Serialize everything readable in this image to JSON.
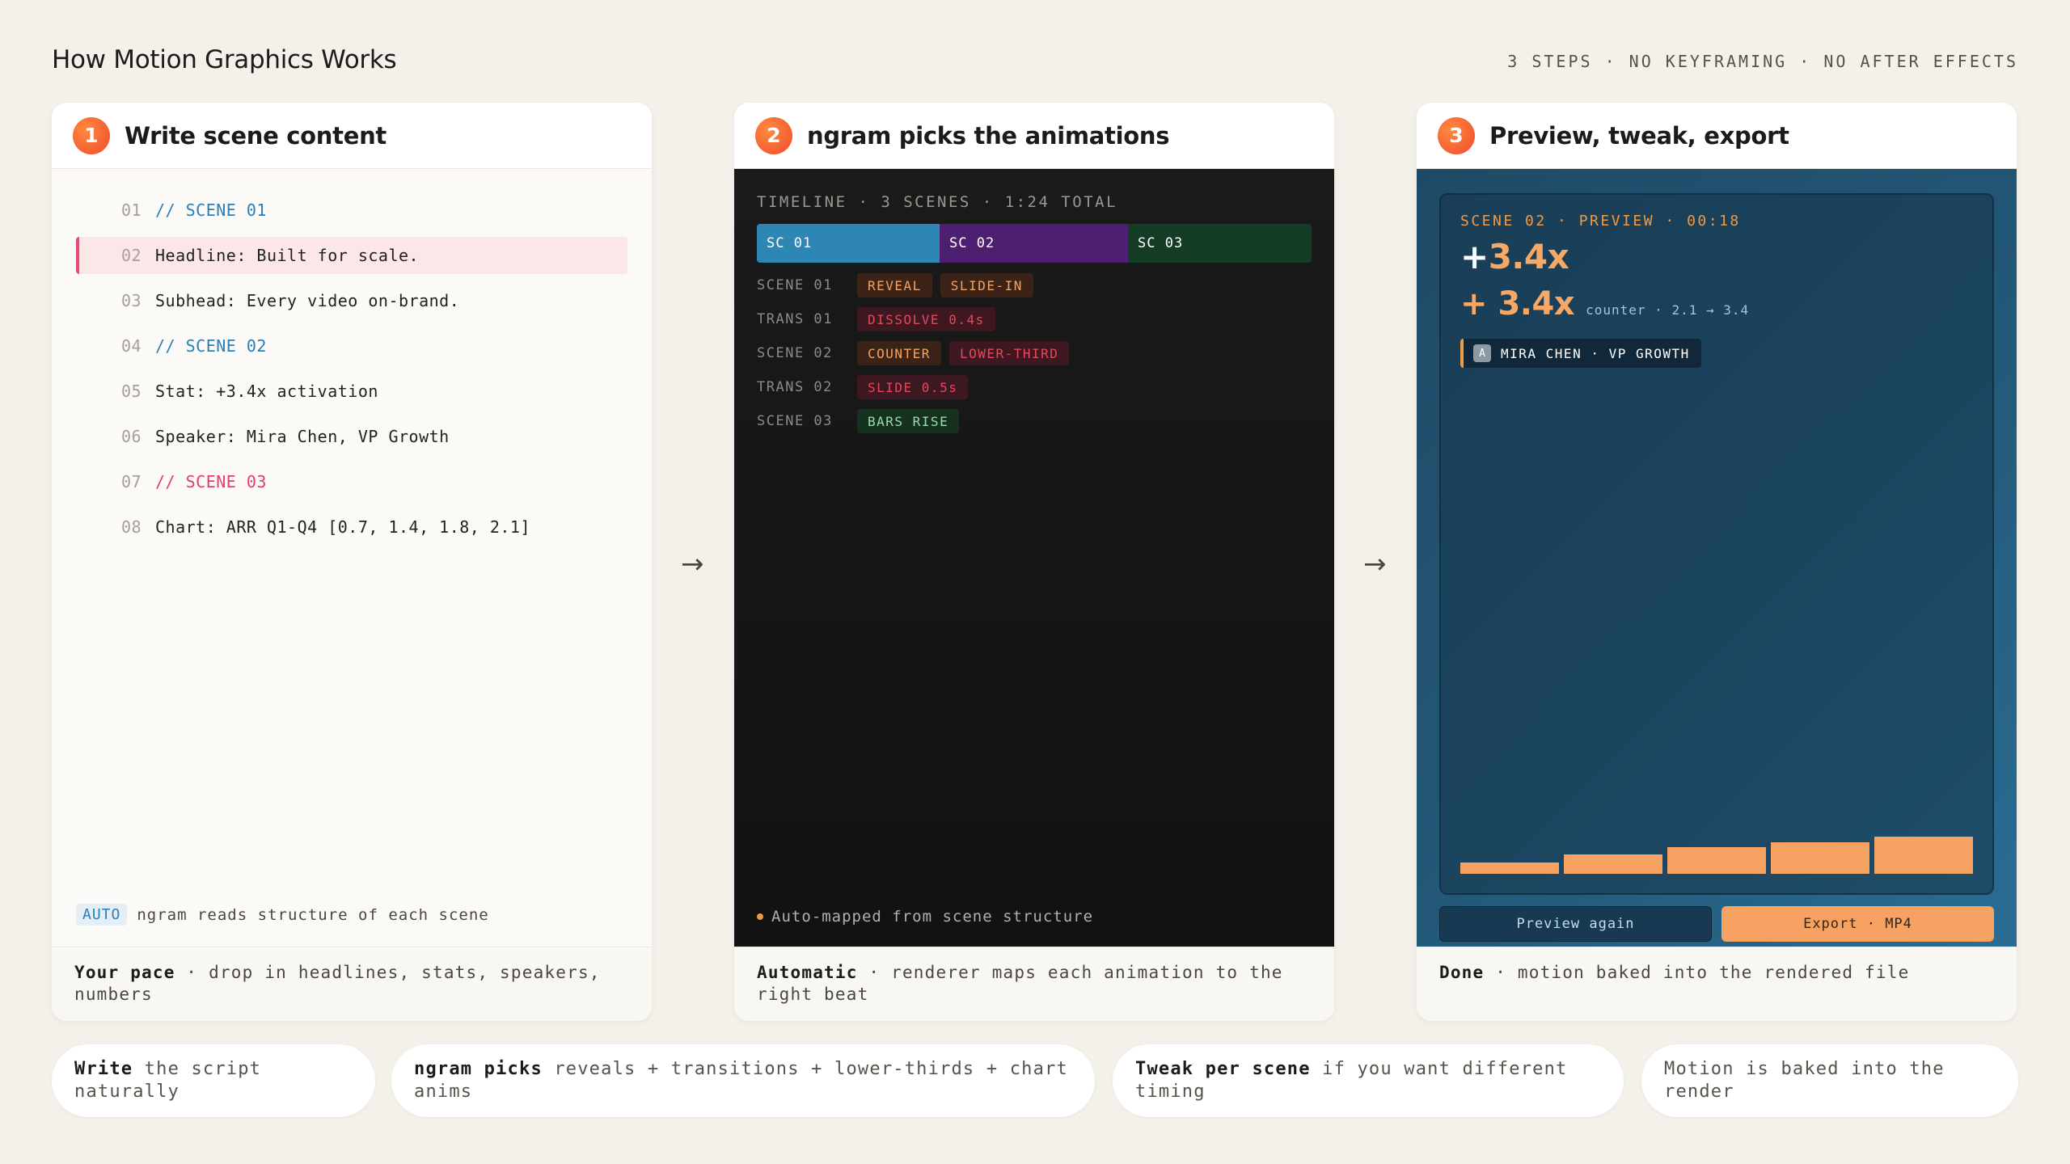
{
  "header": {
    "title": "How Motion Graphics Works",
    "tagline": "3 STEPS · NO KEYFRAMING · NO AFTER EFFECTS"
  },
  "steps": [
    {
      "num": "1",
      "title": "Write scene content",
      "code": [
        {
          "ln": "01",
          "text": "// SCENE 01"
        },
        {
          "ln": "02",
          "text": "Headline: Built for scale."
        },
        {
          "ln": "03",
          "text": "Subhead: Every video on-brand."
        },
        {
          "ln": "04",
          "text": "// SCENE 02"
        },
        {
          "ln": "05",
          "text": "Stat: +3.4x activation"
        },
        {
          "ln": "06",
          "text": "Speaker: Mira Chen, VP Growth"
        },
        {
          "ln": "07",
          "text": "// SCENE 03"
        },
        {
          "ln": "08",
          "text": "Chart: ARR Q1-Q4 [0.7, 1.4, 1.8, 2.1]"
        }
      ],
      "note_tag": "AUTO",
      "note": "ngram reads structure of each scene",
      "foot_bold": "Your pace",
      "foot": " · drop in headlines, stats, speakers, numbers"
    },
    {
      "num": "2",
      "title": "ngram picks the animations",
      "timeline_header": "TIMELINE · 3 SCENES · 1:24 TOTAL",
      "segments": [
        {
          "label": "SC 01",
          "color": "#2e86b4"
        },
        {
          "label": "SC 02",
          "color": "#4d1f70"
        },
        {
          "label": "SC 03",
          "color": "#133b26"
        }
      ],
      "rows": [
        {
          "label": "SCENE 01",
          "chips": [
            {
              "text": "REVEAL",
              "kind": "orange"
            },
            {
              "text": "SLIDE-IN",
              "kind": "orange"
            }
          ]
        },
        {
          "label": "TRANS 01",
          "chips": [
            {
              "text": "DISSOLVE 0.4s",
              "kind": "red"
            }
          ]
        },
        {
          "label": "SCENE 02",
          "chips": [
            {
              "text": "COUNTER",
              "kind": "orange"
            },
            {
              "text": "LOWER-THIRD",
              "kind": "red"
            }
          ]
        },
        {
          "label": "TRANS 02",
          "chips": [
            {
              "text": "SLIDE 0.5s",
              "kind": "red"
            }
          ]
        },
        {
          "label": "SCENE 03",
          "chips": [
            {
              "text": "BARS RISE",
              "kind": "green"
            }
          ]
        }
      ],
      "note": "Auto-mapped from scene structure",
      "foot_bold": "Automatic",
      "foot": " · renderer maps each animation to the right beat"
    },
    {
      "num": "3",
      "title": "Preview, tweak, export",
      "preview_header": "SCENE 02 · PREVIEW · 00:18",
      "stat_plus": "+",
      "stat_value": "3.4x",
      "stat_value_2": "+ 3.4x",
      "stat_sub": "counter · 2.1 → 3.4",
      "avatar": "A",
      "lower_third": "MIRA CHEN · VP GROWTH",
      "bars": [
        0.28,
        0.5,
        0.7,
        0.84,
        1.0
      ],
      "btn_preview": "Preview again",
      "btn_export": "Export · MP4",
      "foot_bold": "Done",
      "foot": " · motion baked into the rendered file"
    }
  ],
  "arrow": "→",
  "pills": [
    {
      "bold": "Write",
      "text": " the script naturally"
    },
    {
      "bold": "ngram picks",
      "text": " reveals + transitions + lower-thirds + chart anims"
    },
    {
      "bold": "Tweak per scene",
      "text": " if you want different timing"
    },
    {
      "bold": "",
      "text": "Motion is baked into the render"
    }
  ],
  "colors": {
    "accent_orange": "#f5a262",
    "accent_pink": "#ea4a6e",
    "code_blue": "#2b7fb8",
    "background": "#f4f1ea"
  }
}
